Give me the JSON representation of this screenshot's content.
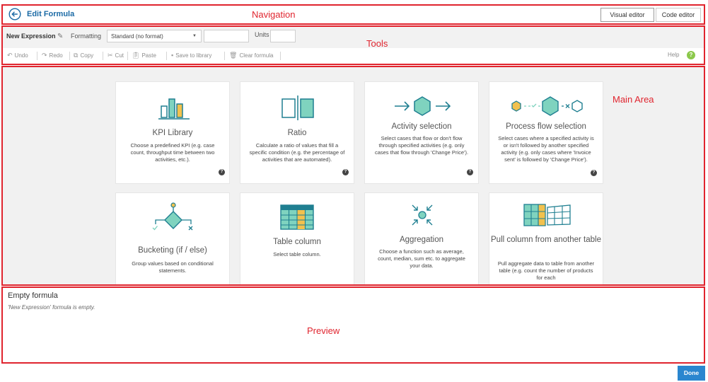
{
  "navigation": {
    "title": "Edit Formula",
    "region_label": "Navigation",
    "editor_tabs": [
      {
        "label": "Visual editor",
        "active": true
      },
      {
        "label": "Code editor",
        "active": false
      }
    ]
  },
  "tools": {
    "region_label": "Tools",
    "expression_name": "New Expression",
    "formatting_label": "Formatting",
    "formatting_value": "Standard (no format)",
    "units_label": "Units",
    "units_value": "",
    "actions": [
      {
        "label": "Undo",
        "icon": "undo-icon"
      },
      {
        "label": "Redo",
        "icon": "redo-icon"
      },
      {
        "label": "Copy",
        "icon": "copy-icon"
      },
      {
        "label": "Cut",
        "icon": "cut-icon"
      },
      {
        "label": "Paste",
        "icon": "paste-icon"
      },
      {
        "label": "Save to library",
        "icon": "save-icon"
      },
      {
        "label": "Clear formula",
        "icon": "trash-icon"
      }
    ],
    "help_label": "Help"
  },
  "main": {
    "region_label": "Main Area",
    "cards": [
      {
        "title": "KPI Library",
        "description": "Choose a predefined KPI (e.g. case count, throughput time between two activities, etc.).",
        "icon": "kpi-library-icon"
      },
      {
        "title": "Ratio",
        "description": "Calculate a ratio of values that fill a specific condition (e.g. the percentage of activities that are automated).",
        "icon": "ratio-icon"
      },
      {
        "title": "Activity selection",
        "description": "Select cases that flow or don't flow through specified activities (e.g. only cases that flow through 'Change Price').",
        "icon": "activity-selection-icon"
      },
      {
        "title": "Process flow selection",
        "description": "Select cases where a specified activity is or isn't followed by another specified activity (e.g. only cases where 'Invoice sent' is followed by 'Change Price').",
        "icon": "process-flow-icon"
      },
      {
        "title": "Bucketing (if / else)",
        "description": "Group values based on conditional statements.",
        "icon": "bucketing-icon"
      },
      {
        "title": "Table column",
        "description": "Select table column.",
        "icon": "table-column-icon"
      },
      {
        "title": "Aggregation",
        "description": "Choose a function such as average, count, median, sum etc. to aggregate your data.",
        "icon": "aggregation-icon"
      },
      {
        "title": "Pull column from another table",
        "description": "Pull aggregate data to table from another table (e.g. count the number of products for each",
        "icon": "pull-column-icon"
      }
    ]
  },
  "preview": {
    "region_label": "Preview",
    "title": "Empty formula",
    "message": "'New Expression' formula is empty."
  },
  "footer": {
    "done_label": "Done"
  },
  "colors": {
    "accent": "#1b6aa5",
    "teal": "#1f7f91",
    "mint": "#7fd3bf",
    "gold": "#f2c14e",
    "region_border": "#e0242e",
    "done_button": "#2a86cf"
  }
}
